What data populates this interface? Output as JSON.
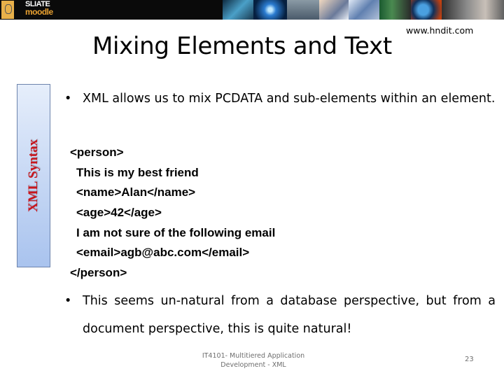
{
  "banner": {
    "brand_top": "SLIATE",
    "brand_bottom": "moodle"
  },
  "site_url": "www.hndit.com",
  "slide": {
    "title": "Mixing Elements and Text",
    "side_label": "XML Syntax",
    "bullets": [
      {
        "marker": "•",
        "text": "XML allows us to mix PCDATA and sub-elements within an element."
      },
      {
        "marker": "•",
        "text": "This seems un-natural from a database perspective, but from a document perspective, this is quite natural!"
      }
    ],
    "code_lines": [
      {
        "text": "<person>",
        "indent": false
      },
      {
        "text": "This is my best friend",
        "indent": true
      },
      {
        "text": "<name>Alan</name>",
        "indent": true
      },
      {
        "text": "<age>42</age>",
        "indent": true
      },
      {
        "text": "I am not sure of the following email",
        "indent": true
      },
      {
        "text": "<email>agb@abc.com</email>",
        "indent": true
      },
      {
        "text": "</person>",
        "indent": false
      }
    ]
  },
  "footer": {
    "line1": "IT4101- Multitiered Application",
    "line2": "Development - XML",
    "slide_number": "23"
  },
  "colors": {
    "side_label": "#c8161d",
    "side_box_top": "#e6eefb",
    "side_box_bottom": "#a9c3ee",
    "footer_text": "#6e6e6e"
  }
}
